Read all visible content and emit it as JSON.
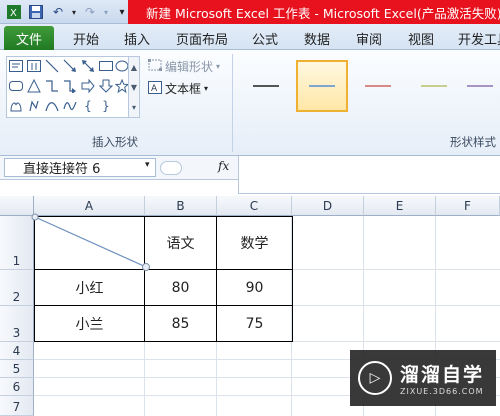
{
  "app": {
    "title": "新建 Microsoft Excel 工作表 - Microsoft Excel(产品激活失败)"
  },
  "quick_access": {
    "save_icon": "save-icon",
    "undo_icon": "undo-icon",
    "redo_icon": "redo-icon",
    "customize_icon": "customize-icon"
  },
  "ribbon": {
    "tabs": [
      {
        "label": "文件"
      },
      {
        "label": "开始"
      },
      {
        "label": "插入"
      },
      {
        "label": "页面布局"
      },
      {
        "label": "公式"
      },
      {
        "label": "数据"
      },
      {
        "label": "审阅"
      },
      {
        "label": "视图"
      },
      {
        "label": "开发工具"
      }
    ],
    "groups": {
      "insert_shapes": "插入形状",
      "shape_styles": "形状样式"
    },
    "commands": {
      "edit_shape": "编辑形状",
      "text_box": "文本框"
    },
    "style_colors": [
      "#555555",
      "#7ea6cf",
      "#d98a86",
      "#c7cf8e",
      "#a893c2"
    ]
  },
  "formula_bar": {
    "name_box": "直接连接符 6",
    "fx_label": "fx",
    "value": ""
  },
  "sheet": {
    "columns": [
      "A",
      "B",
      "C",
      "D",
      "E",
      "F"
    ],
    "rows": [
      "1",
      "2",
      "3",
      "4",
      "5",
      "6",
      "7"
    ],
    "cells": {
      "B1": "语文",
      "C1": "数学",
      "A2": "小红",
      "B2": "80",
      "C2": "90",
      "A3": "小兰",
      "B3": "85",
      "C3": "75"
    }
  },
  "watermark": {
    "main": "溜溜自学",
    "sub": "ZIXUE.3D66.COM"
  }
}
